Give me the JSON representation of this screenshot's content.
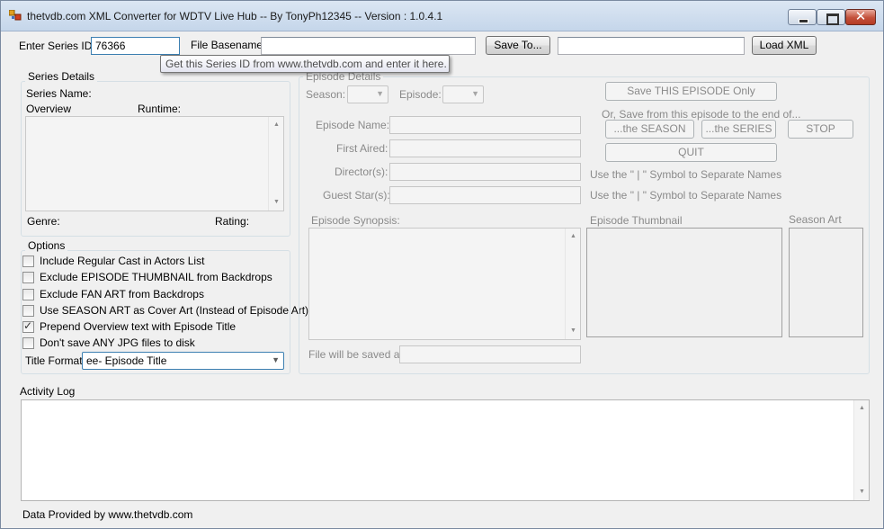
{
  "window": {
    "title": "thetvdb.com XML Converter for WDTV Live Hub -- By TonyPh12345 -- Version : 1.0.4.1"
  },
  "top": {
    "series_id_label": "Enter Series ID",
    "series_id_value": "76366",
    "basename_label": "File Basename",
    "basename_value": "",
    "save_to_label": "Save To...",
    "save_path_value": "",
    "load_xml_label": "Load XML",
    "tooltip": "Get this Series ID from www.thetvdb.com and enter it here."
  },
  "series": {
    "group_title": "Series Details",
    "name_label": "Series Name:",
    "overview_label": "Overview",
    "runtime_label": "Runtime:",
    "genre_label": "Genre:",
    "rating_label": "Rating:"
  },
  "options": {
    "group_title": "Options",
    "items": [
      {
        "label": "Include Regular Cast in Actors List",
        "checked": false
      },
      {
        "label": "Exclude EPISODE THUMBNAIL from Backdrops",
        "checked": false
      },
      {
        "label": "Exclude FAN ART from Backdrops",
        "checked": false
      },
      {
        "label": "Use SEASON ART as Cover Art (Instead of Episode Art)",
        "checked": false
      },
      {
        "label": "Prepend Overview text with Episode Title",
        "checked": true
      },
      {
        "label": "Don't save ANY JPG files to disk",
        "checked": false
      }
    ],
    "title_format_label": "Title Format :",
    "title_format_value": "ee- Episode Title"
  },
  "episode": {
    "group_title": "Episode Details",
    "season_label": "Season:",
    "episode_label": "Episode:",
    "name_label": "Episode Name:",
    "first_aired_label": "First Aired:",
    "directors_label": "Director(s):",
    "guest_stars_label": "Guest Star(s):",
    "synopsis_label": "Episode Synopsis:",
    "thumbnail_label": "Episode Thumbnail",
    "season_art_label": "Season Art",
    "saved_as_label": "File will be saved as:",
    "save_episode_label": "Save THIS EPISODE Only",
    "save_range_hint": "Or, Save from this episode to the end of...",
    "the_season_label": "...the SEASON",
    "the_series_label": "...the SERIES",
    "stop_label": "STOP",
    "quit_label": "QUIT",
    "separator_hint_1": "Use the \" | \" Symbol to Separate Names",
    "separator_hint_2": "Use the \" | \" Symbol to Separate Names"
  },
  "log": {
    "title": "Activity Log"
  },
  "footer": {
    "credit": "Data Provided by www.thetvdb.com"
  }
}
